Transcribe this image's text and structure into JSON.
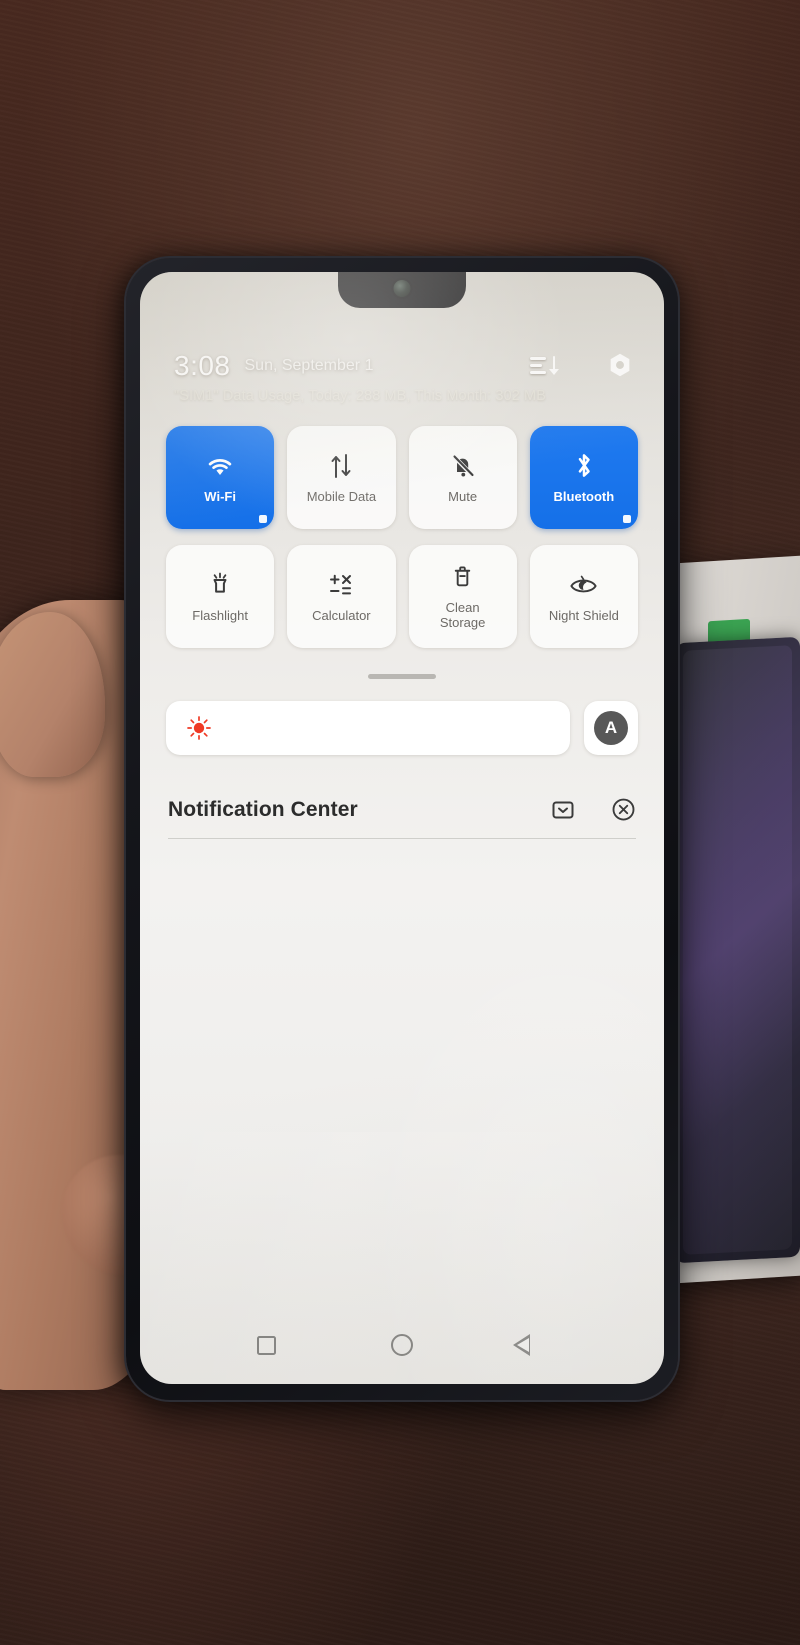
{
  "status": {
    "time": "3:08",
    "date": "Sun, September 1",
    "order_icon": "sort-order-icon",
    "settings_icon": "gear-icon"
  },
  "data_usage": {
    "text": "\"SIM1\" Data Usage, Today: 288 MB, This Month: 302 MB"
  },
  "quick_settings": {
    "tiles": [
      {
        "label": "Wi-Fi",
        "icon": "wifi-icon",
        "active": true
      },
      {
        "label": "Mobile Data",
        "icon": "mobile-data-icon",
        "active": false
      },
      {
        "label": "Mute",
        "icon": "bell-muted-icon",
        "active": false
      },
      {
        "label": "Bluetooth",
        "icon": "bluetooth-icon",
        "active": true
      },
      {
        "label": "Flashlight",
        "icon": "flashlight-icon",
        "active": false
      },
      {
        "label": "Calculator",
        "icon": "calculator-icon",
        "active": false
      },
      {
        "label": "Clean\nStorage",
        "icon": "clean-storage-icon",
        "active": false
      },
      {
        "label": "Night Shield",
        "icon": "night-shield-icon",
        "active": false
      }
    ],
    "active_color": "#1f7af0",
    "tile_color": "#fcfcfb",
    "label_color": "#6d6a66"
  },
  "brightness": {
    "sun_icon": "brightness-sun-icon",
    "sun_color": "#ef3a25",
    "level_percent": 2,
    "auto_label": "A",
    "auto_name": "auto-brightness-toggle"
  },
  "notifications": {
    "title": "Notification Center",
    "settings_icon": "notification-settings-icon",
    "clear_icon": "clear-all-icon",
    "items": []
  },
  "navbar": {
    "recents_label": "Recents",
    "home_label": "Home",
    "back_label": "Back",
    "icon_color": "#70706e"
  }
}
